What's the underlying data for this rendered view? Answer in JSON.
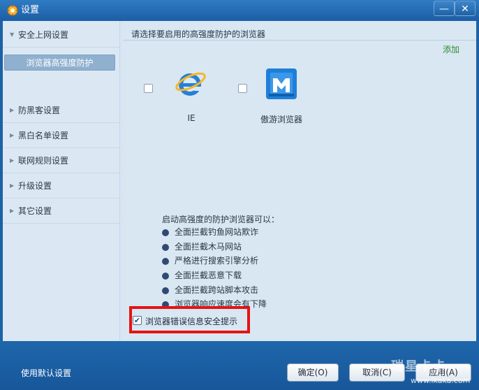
{
  "window": {
    "title": "设置",
    "minimize": "—",
    "close": "✕"
  },
  "sidebar": {
    "items": [
      {
        "label": "安全上网设置",
        "arrow": "▼"
      },
      {
        "label": "防黑客设置",
        "arrow": "▶"
      },
      {
        "label": "黑白名单设置",
        "arrow": "▶"
      },
      {
        "label": "联网规则设置",
        "arrow": "▶"
      },
      {
        "label": "升级设置",
        "arrow": "▶"
      },
      {
        "label": "其它设置",
        "arrow": "▶"
      }
    ],
    "selected_sub": "浏览器高强度防护"
  },
  "main": {
    "header": "请选择要启用的高强度防护的浏览器",
    "add_link": "添加",
    "browsers": [
      {
        "label": "IE",
        "icon": "ie-icon",
        "checked": false
      },
      {
        "label": "傲游浏览器",
        "icon": "maxthon-icon",
        "checked": false
      }
    ],
    "description": "启动高强度的防护浏览器可以：",
    "features": [
      "全面拦截钓鱼网站欺诈",
      "全面拦截木马网站",
      "严格进行搜索引擎分析",
      "全面拦截恶意下载",
      "全面拦截跨站脚本攻击",
      "浏览器响应速度会有下降"
    ],
    "warning_checkbox": {
      "label": "浏览器错误信息安全提示",
      "checked": true,
      "mark": "✔"
    },
    "highlight_color": "#e41414"
  },
  "footer": {
    "default_link": "使用默认设置",
    "ok": "确定(O)",
    "cancel": "取消(C)",
    "apply": "应用(A)",
    "watermark_text": "瑞星卡卡",
    "watermark_url": "www.ikaka.com"
  }
}
